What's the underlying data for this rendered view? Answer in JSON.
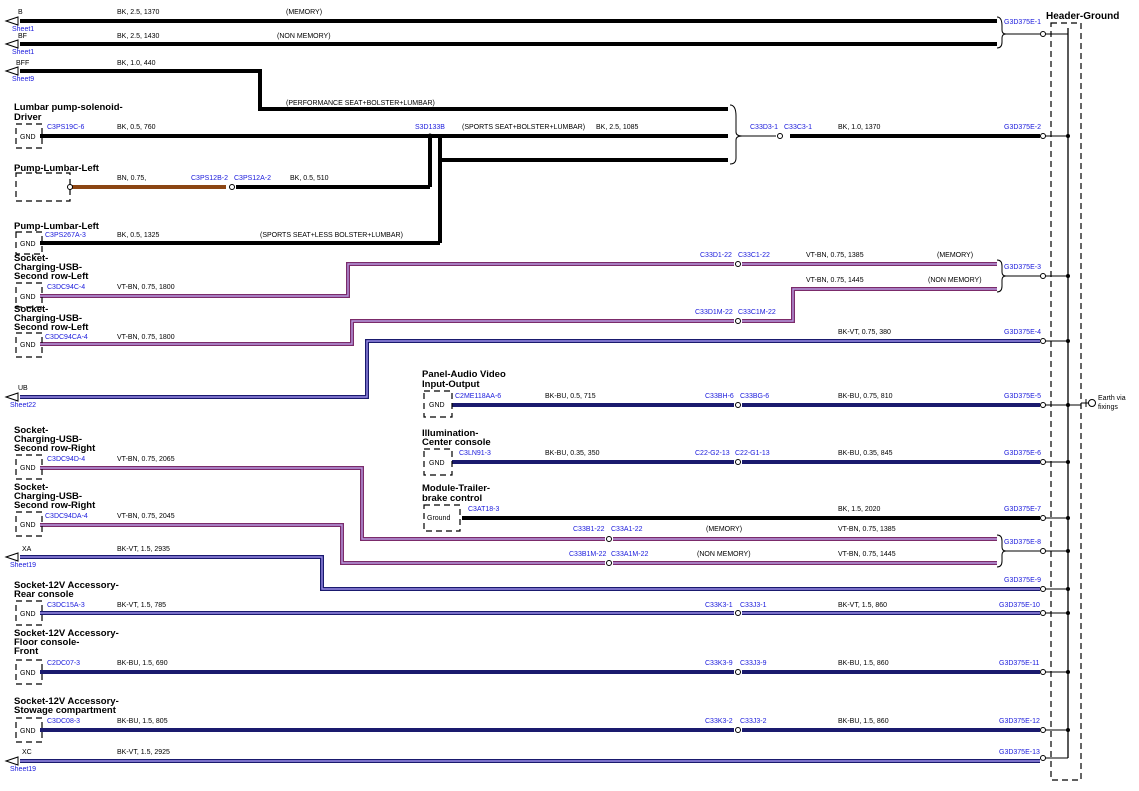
{
  "header": {
    "title": "Header-Ground",
    "earth_label": [
      "Earth via",
      "fixings"
    ]
  },
  "colors": {
    "BK": "#000000",
    "BN": "#8B4513",
    "VT_BN": "#7b2b6a",
    "BU": "#1a1a6e",
    "VT": "#7a52c7",
    "text_blue": "#1a1adc"
  },
  "offsheet": [
    {
      "name": "B",
      "sheet": "Sheet1"
    },
    {
      "name": "BF",
      "sheet": "Sheet1"
    },
    {
      "name": "BFF",
      "sheet": "Sheet9"
    },
    {
      "name": "UB",
      "sheet": "Sheet22"
    },
    {
      "name": "XA",
      "sheet": "Sheet19"
    },
    {
      "name": "XC",
      "sheet": "Sheet19"
    }
  ],
  "components": [
    {
      "title": [
        "Lumbar pump-solenoid-",
        "Driver"
      ],
      "gnd": "GND"
    },
    {
      "title": [
        "Pump-Lumbar-Left"
      ],
      "gnd": ""
    },
    {
      "title": [
        "Pump-Lumbar-Left"
      ],
      "gnd": "GND"
    },
    {
      "title": [
        "Socket-",
        "Charging-USB-",
        "Second row-Left"
      ],
      "gnd": "GND"
    },
    {
      "title": [
        "Socket-",
        "Charging-USB-",
        "Second row-Left"
      ],
      "gnd": "GND"
    },
    {
      "title": [
        "Panel-Audio Video",
        "Input-Output"
      ],
      "gnd": "GND"
    },
    {
      "title": [
        "Illumination-",
        "Center console"
      ],
      "gnd": "GND"
    },
    {
      "title": [
        "Module-Trailer-",
        "brake control"
      ],
      "gnd": "Ground"
    },
    {
      "title": [
        "Socket-",
        "Charging-USB-",
        "Second row-Right"
      ],
      "gnd": "GND"
    },
    {
      "title": [
        "Socket-",
        "Charging-USB-",
        "Second row-Right"
      ],
      "gnd": "GND"
    },
    {
      "title": [
        "Socket-12V Accessory-",
        "Rear console"
      ],
      "gnd": "GND"
    },
    {
      "title": [
        "Socket-12V Accessory-",
        "Floor console-",
        "Front"
      ],
      "gnd": "GND"
    },
    {
      "title": [
        "Socket-12V Accessory-",
        "Stowage compartment"
      ],
      "gnd": "GND"
    }
  ],
  "wire_labels": [
    "BK, 2.5, 1370",
    "(MEMORY)",
    "BK, 2.5, 1430",
    "(NON MEMORY)",
    "BK, 1.0, 440",
    "(PERFORMANCE SEAT+BOLSTER+LUMBAR)",
    "BK, 0.5, 760",
    "(SPORTS SEAT+BOLSTER+LUMBAR)",
    "BK, 2.5, 1085",
    "BK, 1.0, 1370",
    "BN, 0.75,",
    "BK, 0.5, 510",
    "BK, 0.5, 1325",
    "(SPORTS SEAT+LESS BOLSTER+LUMBAR)",
    "VT-BN, 0.75, 1385",
    "(MEMORY)",
    "VT-BN, 0.75, 1445",
    "(NON MEMORY)",
    "VT-BN, 0.75, 1800",
    "VT-BN, 0.75, 1800",
    "BK-VT, 0.75, 380",
    "BK-BU, 0.5, 715",
    "BK-BU, 0.75, 810",
    "BK-BU, 0.35, 350",
    "BK-BU, 0.35, 845",
    "BK, 1.5, 2020",
    "VT-BN, 0.75, 2065",
    "VT-BN, 0.75, 2045",
    "(MEMORY)",
    "VT-BN, 0.75, 1385",
    "BK-VT, 1.5, 2935",
    "(NON MEMORY)",
    "VT-BN, 0.75, 1445",
    "BK-VT, 1.5, 785",
    "BK-VT, 1.5, 860",
    "BK-BU, 1.5, 690",
    "BK-BU, 1.5, 860",
    "BK-BU, 1.5, 805",
    "BK-BU, 1.5, 860",
    "BK-VT, 1.5, 2925"
  ],
  "connectors": [
    "G3D375E-1",
    "C3PS19C-6",
    "S3D133B",
    "C33D3-1",
    "C33C3-1",
    "G3D375E-2",
    "C3PS12B-2",
    "C3PS12A-2",
    "C3PS267A-3",
    "C33D1-22",
    "C33C1-22",
    "G3D375E-3",
    "C3DC94C-4",
    "C33D1M-22",
    "C33C1M-22",
    "C3DC94CA-4",
    "G3D375E-4",
    "C2ME118AA-6",
    "C33BH-6",
    "C33BG-6",
    "G3D375E-5",
    "C3LN91-3",
    "C22-G2-13",
    "C22-G1-13",
    "G3D375E-6",
    "C3AT18-3",
    "G3D375E-7",
    "C3DC94D-4",
    "C33B1-22",
    "C33A1-22",
    "G3D375E-8",
    "C3DC94DA-4",
    "C33B1M-22",
    "C33A1M-22",
    "G3D375E-9",
    "C3DC15A-3",
    "C33K3-1",
    "C33J3-1",
    "G3D375E-10",
    "C2DC07-3",
    "C33K3-9",
    "C33J3-9",
    "G3D375E-11",
    "C3DC08-3",
    "C33K3-2",
    "C33J3-2",
    "G3D375E-12",
    "G3D375E-13"
  ]
}
